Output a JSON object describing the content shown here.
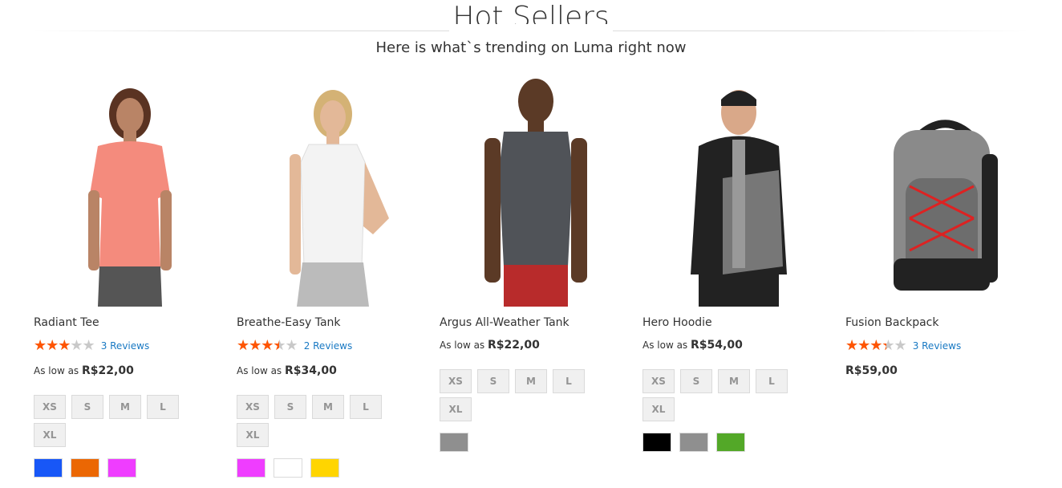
{
  "header": {
    "title": "Hot Sellers",
    "subtitle": "Here is what`s trending on Luma right now"
  },
  "products": [
    {
      "name": "Radiant Tee",
      "rating_percent": 60,
      "reviews": "3 Reviews",
      "price_prefix": "As low as",
      "price": "R$22,00",
      "sizes": [
        "XS",
        "S",
        "M",
        "L",
        "XL"
      ],
      "colors": [
        "#1857f7",
        "#eb6703",
        "#ef3dff"
      ],
      "image": "woman-pink-tee"
    },
    {
      "name": "Breathe-Easy Tank",
      "rating_percent": 70,
      "reviews": "2 Reviews",
      "price_prefix": "As low as",
      "price": "R$34,00",
      "sizes": [
        "XS",
        "S",
        "M",
        "L",
        "XL"
      ],
      "colors": [
        "#ef3dff",
        "#ffffff",
        "#ffd500"
      ],
      "image": "woman-white-tank"
    },
    {
      "name": "Argus All-Weather Tank",
      "price_prefix": "As low as",
      "price": "R$22,00",
      "sizes": [
        "XS",
        "S",
        "M",
        "L",
        "XL"
      ],
      "colors": [
        "#8f8f8f"
      ],
      "image": "man-gray-tank"
    },
    {
      "name": "Hero Hoodie",
      "price_prefix": "As low as",
      "price": "R$54,00",
      "sizes": [
        "XS",
        "S",
        "M",
        "L",
        "XL"
      ],
      "colors": [
        "#000000",
        "#8f8f8f",
        "#53a828"
      ],
      "image": "man-hoodie"
    },
    {
      "name": "Fusion Backpack",
      "rating_percent": 67,
      "reviews": "3 Reviews",
      "price": "R$59,00",
      "image": "backpack"
    }
  ]
}
